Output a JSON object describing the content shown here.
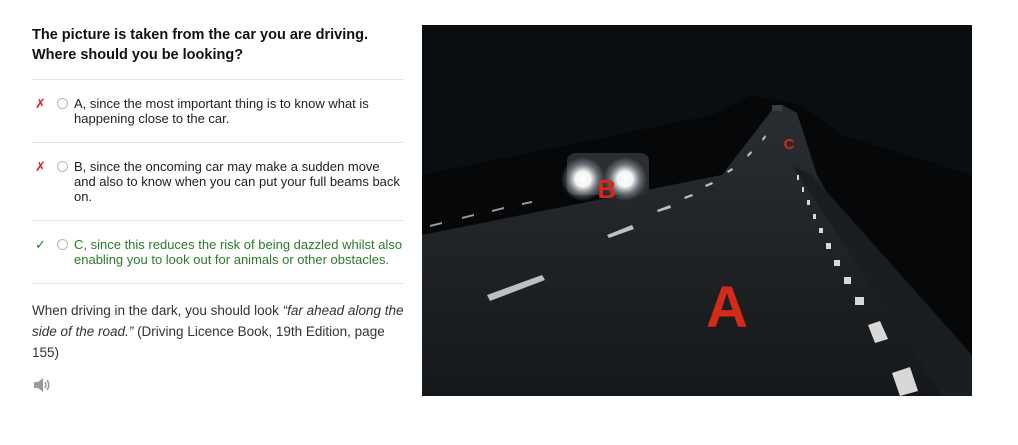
{
  "question": {
    "line1": "The picture is taken from the car you are driving.",
    "line2": "Where should you be looking?"
  },
  "options": [
    {
      "status": "wrong",
      "mark": "✗",
      "text": "A, since the most important thing is to know what is happening close to the car."
    },
    {
      "status": "wrong",
      "mark": "✗",
      "text": "B, since the oncoming car may make a sudden move and also to know when you can put your full beams back on."
    },
    {
      "status": "correct",
      "mark": "✓",
      "text": "C, since this reduces the risk of being dazzled whilst also enabling you to look out for animals or other obstacles."
    }
  ],
  "explanation": {
    "before": "When driving in the dark, you should look ",
    "quote": "“far ahead along the side of the road.”",
    "after": " (Driving Licence Book, 19th Edition, page 155)"
  },
  "image": {
    "label_a": "A",
    "label_b": "B",
    "label_c": "C",
    "label_color": "#d42a1a"
  },
  "icons": {
    "audio": "speaker-icon"
  }
}
